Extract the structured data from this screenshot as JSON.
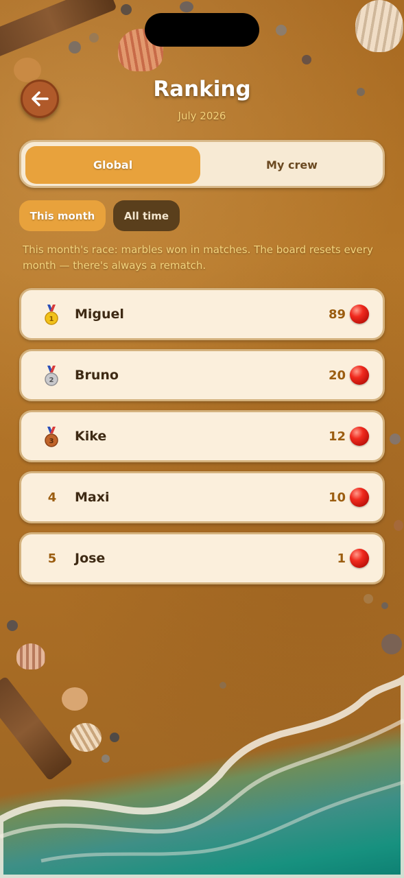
{
  "header": {
    "title": "Ranking",
    "subtitle": "July 2026",
    "back_icon": "arrow-left-icon"
  },
  "scope_tabs": [
    {
      "label": "Global",
      "active": true
    },
    {
      "label": "My crew",
      "active": false
    }
  ],
  "period_tabs": [
    {
      "label": "This month",
      "active": true
    },
    {
      "label": "All time",
      "active": false
    }
  ],
  "description": "This month's race: marbles won in matches. The board resets every month — there's always a rematch.",
  "leaderboard": [
    {
      "rank": "1",
      "medal": "gold-medal-icon",
      "name": "Miguel",
      "score": "89"
    },
    {
      "rank": "2",
      "medal": "silver-medal-icon",
      "name": "Bruno",
      "score": "20"
    },
    {
      "rank": "3",
      "medal": "bronze-medal-icon",
      "name": "Kike",
      "score": "12"
    },
    {
      "rank": "4",
      "medal": null,
      "name": "Maxi",
      "score": "10"
    },
    {
      "rank": "5",
      "medal": null,
      "name": "Jose",
      "score": "1"
    }
  ],
  "colors": {
    "accent": "#e8a23c",
    "card": "#fbefdc",
    "marble": "#e0241a"
  }
}
